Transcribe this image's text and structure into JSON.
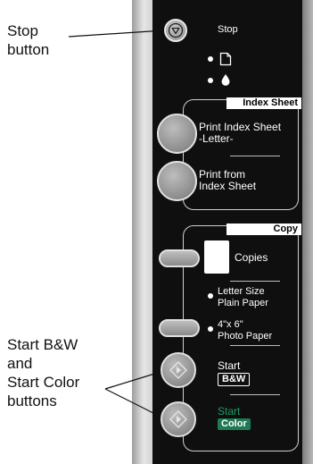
{
  "callouts": {
    "stop": [
      "Stop",
      "button"
    ],
    "start": [
      "Start B&W",
      "and",
      "Start Color",
      "buttons"
    ]
  },
  "panel": {
    "stop_label": "Stop",
    "index_sheet": {
      "tab": "Index Sheet",
      "print_index": [
        "Print Index Sheet",
        "-Letter-"
      ],
      "print_from": [
        "Print from",
        "Index Sheet"
      ]
    },
    "copy": {
      "tab": "Copy",
      "copies": "Copies",
      "letter": [
        "Letter Size",
        "Plain Paper"
      ],
      "photo": [
        "4\"x 6\"",
        "Photo Paper"
      ],
      "start_bw": "Start",
      "bw_badge": "B&W",
      "start_color": "Start",
      "color_badge": "Color"
    }
  },
  "colors": {
    "panel": "#0f0f0f",
    "color_badge": "#1f7a55",
    "bw_badge": "#ffffff"
  },
  "icons": {
    "stop": "stop-icon",
    "paper": "paper-icon",
    "ink": "ink-drop-icon",
    "start": "start-arrow-icon"
  }
}
